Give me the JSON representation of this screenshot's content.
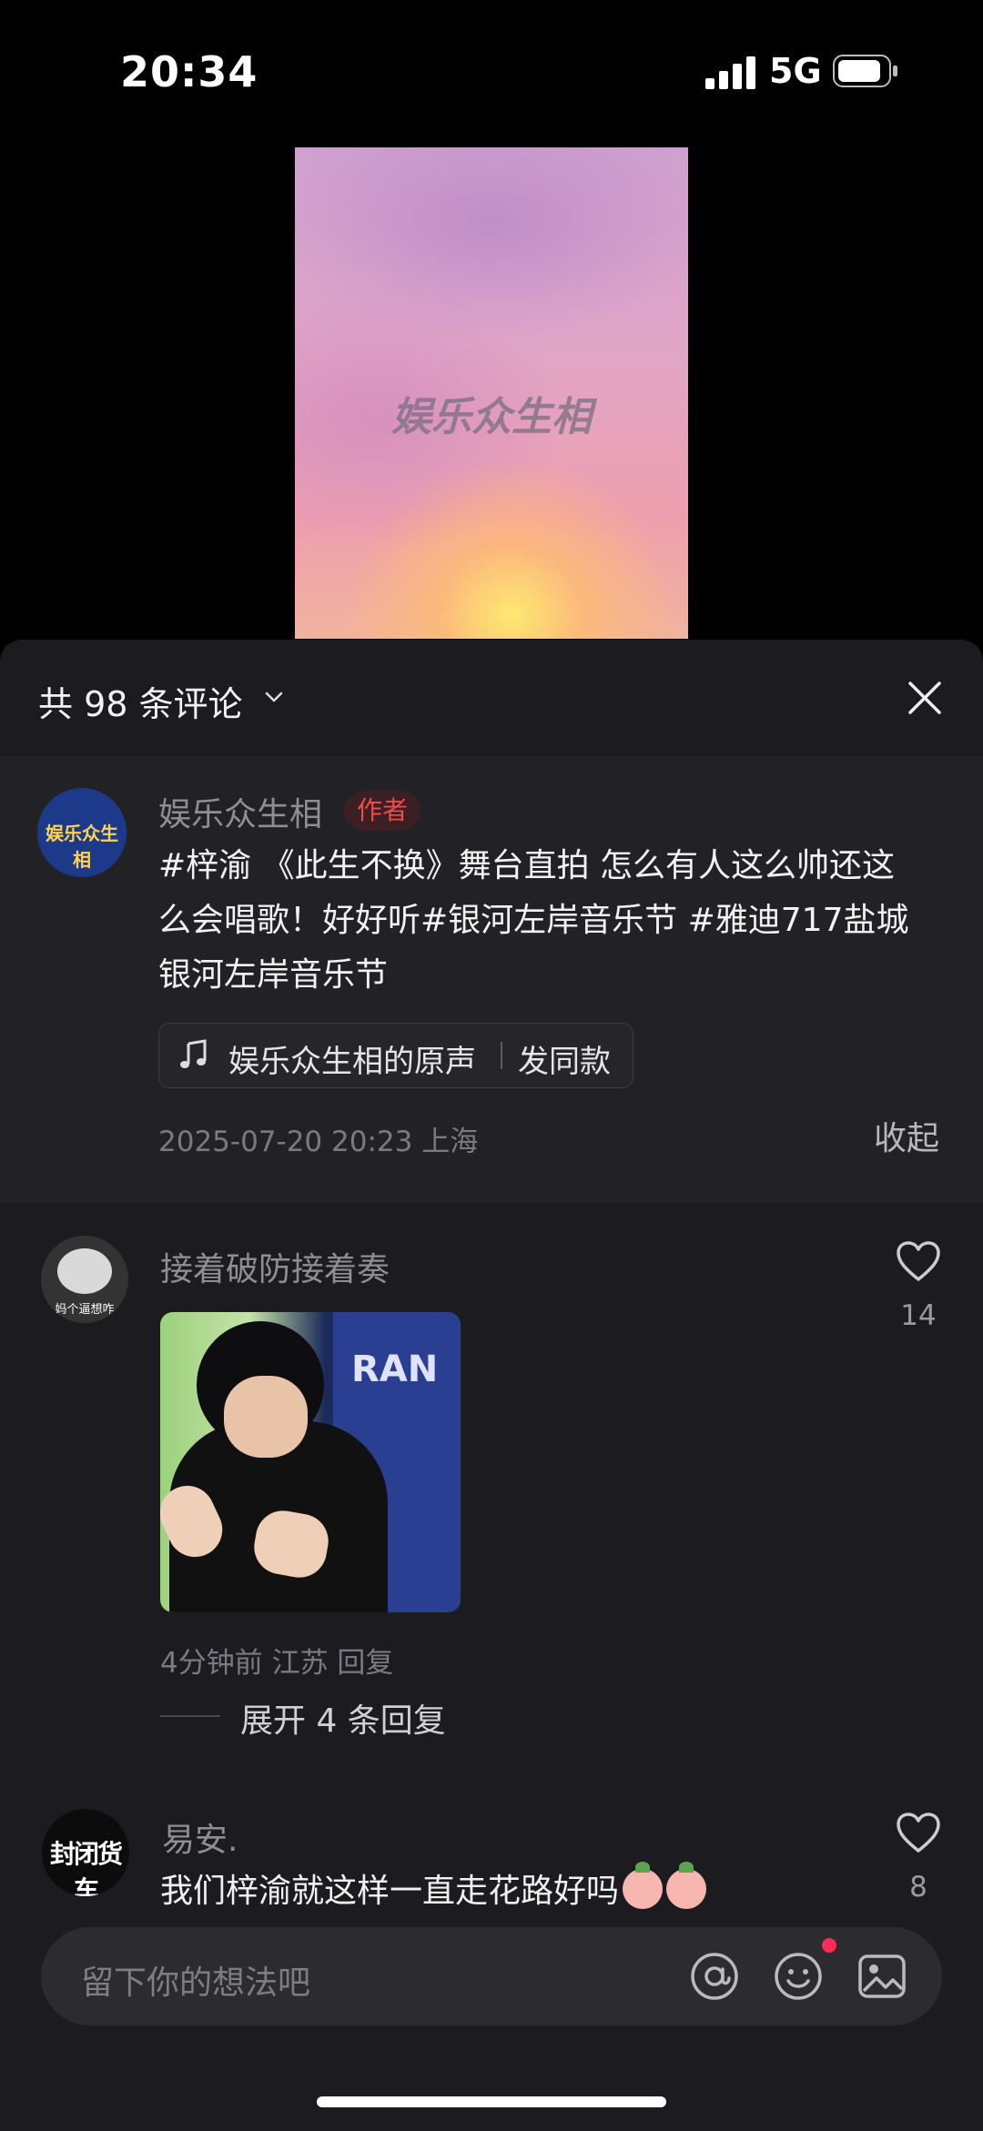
{
  "status_bar": {
    "time": "20:34",
    "network": "5G"
  },
  "video": {
    "watermark": "娱乐众生相"
  },
  "comments_header": {
    "count_label": "共 98 条评论"
  },
  "author_post": {
    "avatar_text": "娱乐众生相",
    "username": "娱乐众生相",
    "badge": "作者",
    "text": "#梓渝 《此生不换》舞台直拍 怎么有人这么帅还这么会唱歌！好好听#银河左岸音乐节 #雅迪717盐城银河左岸音乐节",
    "music_name": "娱乐众生相的原声",
    "music_action": "发同款",
    "meta": "2025-07-20 20:23 上海",
    "collapse_label": "收起"
  },
  "comments": [
    {
      "avatar_caption": "妈个逼想咋",
      "username": "接着破防接着奏",
      "likes": "14",
      "meta": "4分钟前 江苏 回复",
      "expand_label": "展开 4 条回复"
    },
    {
      "avatar_text": "封闭货车",
      "username": "易安.",
      "text": "我们梓渝就这样一直走花路好吗",
      "likes": "8"
    }
  ],
  "input": {
    "placeholder": "留下你的想法吧"
  },
  "icons": [
    "signal-icon",
    "battery-icon",
    "chevron-down-icon",
    "close-icon",
    "music-note-icon",
    "heart-icon",
    "at-icon",
    "emoji-icon",
    "image-icon"
  ]
}
